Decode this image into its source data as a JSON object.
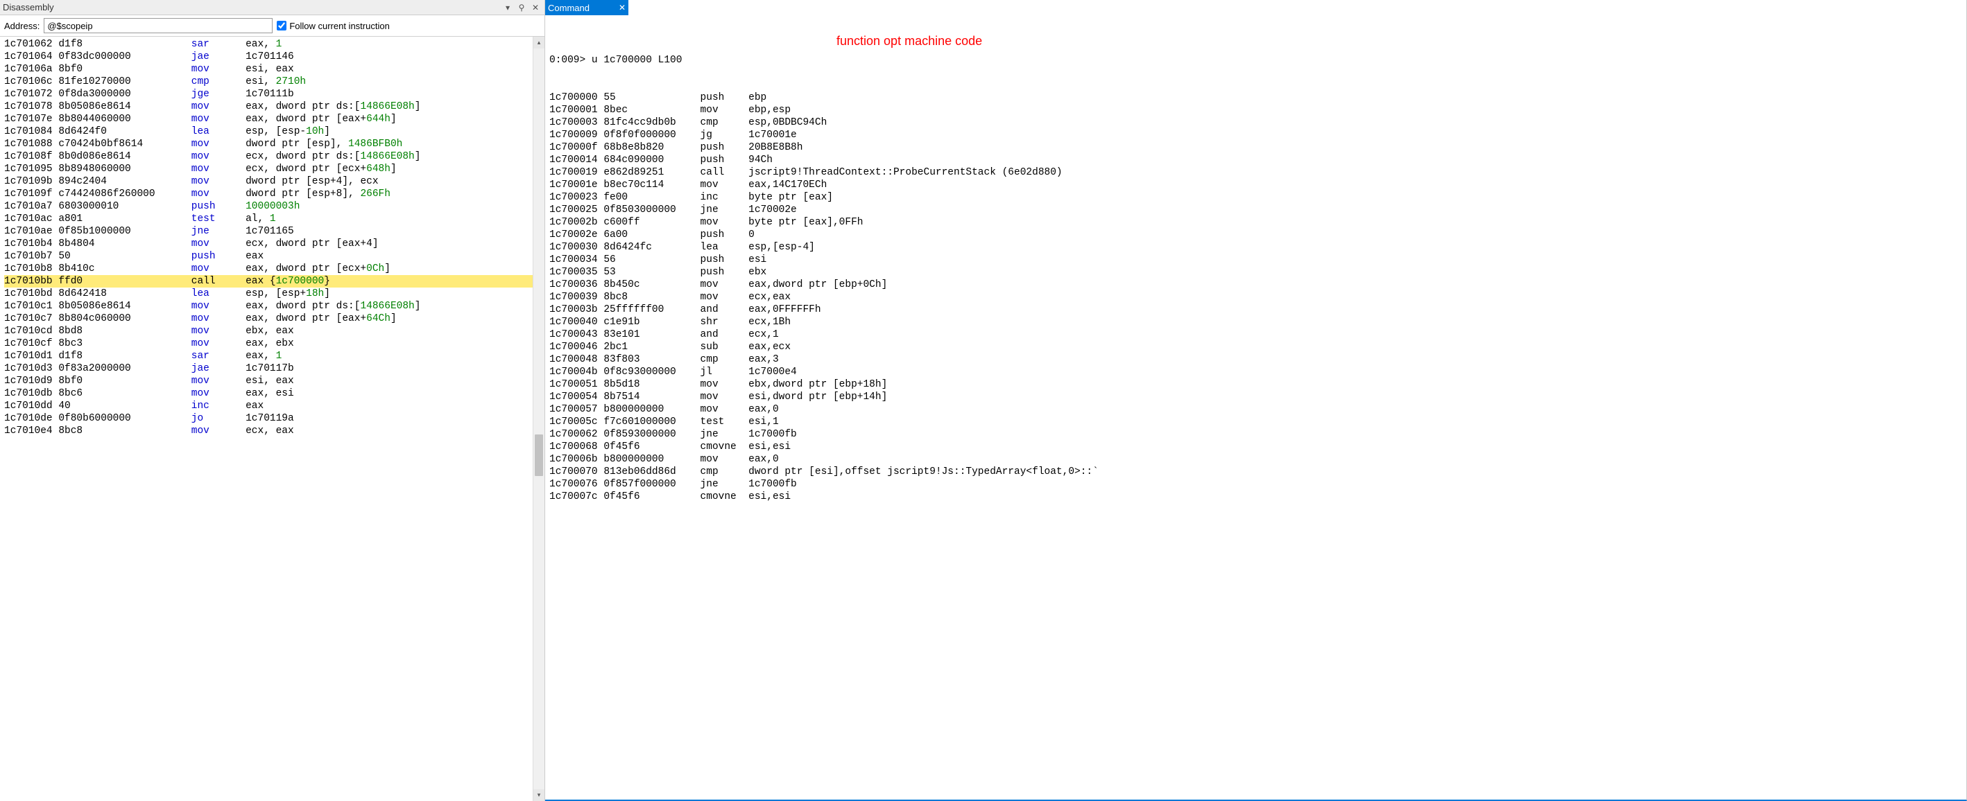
{
  "left": {
    "title": "Disassembly",
    "address_label": "Address:",
    "address_value": "@$scopeip",
    "follow_label": "Follow current instruction",
    "follow_checked": true,
    "icons": {
      "dropdown": "▾",
      "pin": "⚲",
      "close": "✕"
    },
    "highlighted_addr": "1c7010bb",
    "rows": [
      {
        "a": "1c701062",
        "b": "d1f8",
        "m": "sar",
        "o": [
          "eax",
          ", ",
          "1"
        ],
        "ot": [
          "r",
          "p",
          "i"
        ]
      },
      {
        "a": "1c701064",
        "b": "0f83dc000000",
        "m": "jae",
        "o": [
          "1c701146"
        ],
        "ot": [
          "p"
        ]
      },
      {
        "a": "1c70106a",
        "b": "8bf0",
        "m": "mov",
        "o": [
          "esi",
          ", ",
          "eax"
        ],
        "ot": [
          "r",
          "p",
          "r"
        ]
      },
      {
        "a": "1c70106c",
        "b": "81fe10270000",
        "m": "cmp",
        "o": [
          "esi",
          ", ",
          "2710h"
        ],
        "ot": [
          "r",
          "p",
          "i"
        ]
      },
      {
        "a": "1c701072",
        "b": "0f8da3000000",
        "m": "jge",
        "o": [
          "1c70111b"
        ],
        "ot": [
          "p"
        ]
      },
      {
        "a": "1c701078",
        "b": "8b05086e8614",
        "m": "mov",
        "o": [
          "eax",
          ", ",
          "dword ptr ds:[",
          "14866E08h",
          "]"
        ],
        "ot": [
          "r",
          "p",
          "p",
          "i",
          "p"
        ]
      },
      {
        "a": "1c70107e",
        "b": "8b8044060000",
        "m": "mov",
        "o": [
          "eax",
          ", ",
          "dword ptr [eax+",
          "644h",
          "]"
        ],
        "ot": [
          "r",
          "p",
          "p",
          "i",
          "p"
        ]
      },
      {
        "a": "1c701084",
        "b": "8d6424f0",
        "m": "lea",
        "o": [
          "esp",
          ", ",
          "[esp-",
          "10h",
          "]"
        ],
        "ot": [
          "r",
          "p",
          "p",
          "i",
          "p"
        ]
      },
      {
        "a": "1c701088",
        "b": "c70424b0bf8614",
        "m": "mov",
        "o": [
          "dword ptr [esp]",
          ", ",
          "1486BFB0h"
        ],
        "ot": [
          "p",
          "p",
          "i"
        ]
      },
      {
        "a": "1c70108f",
        "b": "8b0d086e8614",
        "m": "mov",
        "o": [
          "ecx",
          ", ",
          "dword ptr ds:[",
          "14866E08h",
          "]"
        ],
        "ot": [
          "r",
          "p",
          "p",
          "i",
          "p"
        ]
      },
      {
        "a": "1c701095",
        "b": "8b8948060000",
        "m": "mov",
        "o": [
          "ecx",
          ", ",
          "dword ptr [ecx+",
          "648h",
          "]"
        ],
        "ot": [
          "r",
          "p",
          "p",
          "i",
          "p"
        ]
      },
      {
        "a": "1c70109b",
        "b": "894c2404",
        "m": "mov",
        "o": [
          "dword ptr [esp+4]",
          ", ",
          "ecx"
        ],
        "ot": [
          "p",
          "p",
          "r"
        ]
      },
      {
        "a": "1c70109f",
        "b": "c74424086f260000",
        "m": "mov",
        "o": [
          "dword ptr [esp+8]",
          ", ",
          "266Fh"
        ],
        "ot": [
          "p",
          "p",
          "i"
        ]
      },
      {
        "a": "1c7010a7",
        "b": "6803000010",
        "m": "push",
        "o": [
          "10000003h"
        ],
        "ot": [
          "i"
        ]
      },
      {
        "a": "1c7010ac",
        "b": "a801",
        "m": "test",
        "o": [
          "al",
          ", ",
          "1"
        ],
        "ot": [
          "r",
          "p",
          "i"
        ]
      },
      {
        "a": "1c7010ae",
        "b": "0f85b1000000",
        "m": "jne",
        "o": [
          "1c701165"
        ],
        "ot": [
          "p"
        ]
      },
      {
        "a": "1c7010b4",
        "b": "8b4804",
        "m": "mov",
        "o": [
          "ecx",
          ", ",
          "dword ptr [eax+4]"
        ],
        "ot": [
          "r",
          "p",
          "p"
        ]
      },
      {
        "a": "1c7010b7",
        "b": "50",
        "m": "push",
        "o": [
          "eax"
        ],
        "ot": [
          "r"
        ]
      },
      {
        "a": "1c7010b8",
        "b": "8b410c",
        "m": "mov",
        "o": [
          "eax",
          ", ",
          "dword ptr [ecx+",
          "0Ch",
          "]"
        ],
        "ot": [
          "r",
          "p",
          "p",
          "i",
          "p"
        ]
      },
      {
        "a": "1c7010bb",
        "b": "ffd0",
        "m": "call",
        "o": [
          "eax",
          " {",
          "1c700000",
          "}"
        ],
        "ot": [
          "r",
          "p",
          "i",
          "p"
        ]
      },
      {
        "a": "1c7010bd",
        "b": "8d642418",
        "m": "lea",
        "o": [
          "esp",
          ", ",
          "[esp+",
          "18h",
          "]"
        ],
        "ot": [
          "r",
          "p",
          "p",
          "i",
          "p"
        ]
      },
      {
        "a": "1c7010c1",
        "b": "8b05086e8614",
        "m": "mov",
        "o": [
          "eax",
          ", ",
          "dword ptr ds:[",
          "14866E08h",
          "]"
        ],
        "ot": [
          "r",
          "p",
          "p",
          "i",
          "p"
        ]
      },
      {
        "a": "1c7010c7",
        "b": "8b804c060000",
        "m": "mov",
        "o": [
          "eax",
          ", ",
          "dword ptr [eax+",
          "64Ch",
          "]"
        ],
        "ot": [
          "r",
          "p",
          "p",
          "i",
          "p"
        ]
      },
      {
        "a": "1c7010cd",
        "b": "8bd8",
        "m": "mov",
        "o": [
          "ebx",
          ", ",
          "eax"
        ],
        "ot": [
          "r",
          "p",
          "r"
        ]
      },
      {
        "a": "1c7010cf",
        "b": "8bc3",
        "m": "mov",
        "o": [
          "eax",
          ", ",
          "ebx"
        ],
        "ot": [
          "r",
          "p",
          "r"
        ]
      },
      {
        "a": "1c7010d1",
        "b": "d1f8",
        "m": "sar",
        "o": [
          "eax",
          ", ",
          "1"
        ],
        "ot": [
          "r",
          "p",
          "i"
        ]
      },
      {
        "a": "1c7010d3",
        "b": "0f83a2000000",
        "m": "jae",
        "o": [
          "1c70117b"
        ],
        "ot": [
          "p"
        ]
      },
      {
        "a": "1c7010d9",
        "b": "8bf0",
        "m": "mov",
        "o": [
          "esi",
          ", ",
          "eax"
        ],
        "ot": [
          "r",
          "p",
          "r"
        ]
      },
      {
        "a": "1c7010db",
        "b": "8bc6",
        "m": "mov",
        "o": [
          "eax",
          ", ",
          "esi"
        ],
        "ot": [
          "r",
          "p",
          "r"
        ]
      },
      {
        "a": "1c7010dd",
        "b": "40",
        "m": "inc",
        "o": [
          "eax"
        ],
        "ot": [
          "r"
        ]
      },
      {
        "a": "1c7010de",
        "b": "0f80b6000000",
        "m": "jo",
        "o": [
          "1c70119a"
        ],
        "ot": [
          "p"
        ]
      },
      {
        "a": "1c7010e4",
        "b": "8bc8",
        "m": "mov",
        "o": [
          "ecx",
          ", ",
          "eax"
        ],
        "ot": [
          "r",
          "p",
          "r"
        ]
      }
    ]
  },
  "right": {
    "title": "Command",
    "close": "✕",
    "annotation": "function opt machine code",
    "prompt": "0:009> u 1c700000 L100",
    "rows": [
      {
        "a": "1c700000",
        "b": "55",
        "m": "push",
        "o": "ebp"
      },
      {
        "a": "1c700001",
        "b": "8bec",
        "m": "mov",
        "o": "ebp,esp"
      },
      {
        "a": "1c700003",
        "b": "81fc4cc9db0b",
        "m": "cmp",
        "o": "esp,0BDBC94Ch"
      },
      {
        "a": "1c700009",
        "b": "0f8f0f000000",
        "m": "jg",
        "o": "1c70001e"
      },
      {
        "a": "1c70000f",
        "b": "68b8e8b820",
        "m": "push",
        "o": "20B8E8B8h"
      },
      {
        "a": "1c700014",
        "b": "684c090000",
        "m": "push",
        "o": "94Ch"
      },
      {
        "a": "1c700019",
        "b": "e862d89251",
        "m": "call",
        "o": "jscript9!ThreadContext::ProbeCurrentStack (6e02d880)"
      },
      {
        "a": "1c70001e",
        "b": "b8ec70c114",
        "m": "mov",
        "o": "eax,14C170ECh"
      },
      {
        "a": "1c700023",
        "b": "fe00",
        "m": "inc",
        "o": "byte ptr [eax]"
      },
      {
        "a": "1c700025",
        "b": "0f8503000000",
        "m": "jne",
        "o": "1c70002e"
      },
      {
        "a": "1c70002b",
        "b": "c600ff",
        "m": "mov",
        "o": "byte ptr [eax],0FFh"
      },
      {
        "a": "1c70002e",
        "b": "6a00",
        "m": "push",
        "o": "0"
      },
      {
        "a": "1c700030",
        "b": "8d6424fc",
        "m": "lea",
        "o": "esp,[esp-4]"
      },
      {
        "a": "1c700034",
        "b": "56",
        "m": "push",
        "o": "esi"
      },
      {
        "a": "1c700035",
        "b": "53",
        "m": "push",
        "o": "ebx"
      },
      {
        "a": "1c700036",
        "b": "8b450c",
        "m": "mov",
        "o": "eax,dword ptr [ebp+0Ch]"
      },
      {
        "a": "1c700039",
        "b": "8bc8",
        "m": "mov",
        "o": "ecx,eax"
      },
      {
        "a": "1c70003b",
        "b": "25ffffff00",
        "m": "and",
        "o": "eax,0FFFFFFh"
      },
      {
        "a": "1c700040",
        "b": "c1e91b",
        "m": "shr",
        "o": "ecx,1Bh"
      },
      {
        "a": "1c700043",
        "b": "83e101",
        "m": "and",
        "o": "ecx,1"
      },
      {
        "a": "1c700046",
        "b": "2bc1",
        "m": "sub",
        "o": "eax,ecx"
      },
      {
        "a": "1c700048",
        "b": "83f803",
        "m": "cmp",
        "o": "eax,3"
      },
      {
        "a": "1c70004b",
        "b": "0f8c93000000",
        "m": "jl",
        "o": "1c7000e4"
      },
      {
        "a": "1c700051",
        "b": "8b5d18",
        "m": "mov",
        "o": "ebx,dword ptr [ebp+18h]"
      },
      {
        "a": "1c700054",
        "b": "8b7514",
        "m": "mov",
        "o": "esi,dword ptr [ebp+14h]"
      },
      {
        "a": "1c700057",
        "b": "b800000000",
        "m": "mov",
        "o": "eax,0"
      },
      {
        "a": "1c70005c",
        "b": "f7c601000000",
        "m": "test",
        "o": "esi,1"
      },
      {
        "a": "1c700062",
        "b": "0f8593000000",
        "m": "jne",
        "o": "1c7000fb"
      },
      {
        "a": "1c700068",
        "b": "0f45f6",
        "m": "cmovne",
        "o": "esi,esi"
      },
      {
        "a": "1c70006b",
        "b": "b800000000",
        "m": "mov",
        "o": "eax,0"
      },
      {
        "a": "1c700070",
        "b": "813eb06dd86d",
        "m": "cmp",
        "o": "dword ptr [esi],offset jscript9!Js::TypedArray<float,0>::`"
      },
      {
        "a": "1c700076",
        "b": "0f857f000000",
        "m": "jne",
        "o": "1c7000fb"
      },
      {
        "a": "1c70007c",
        "b": "0f45f6",
        "m": "cmovne",
        "o": "esi,esi"
      }
    ]
  }
}
